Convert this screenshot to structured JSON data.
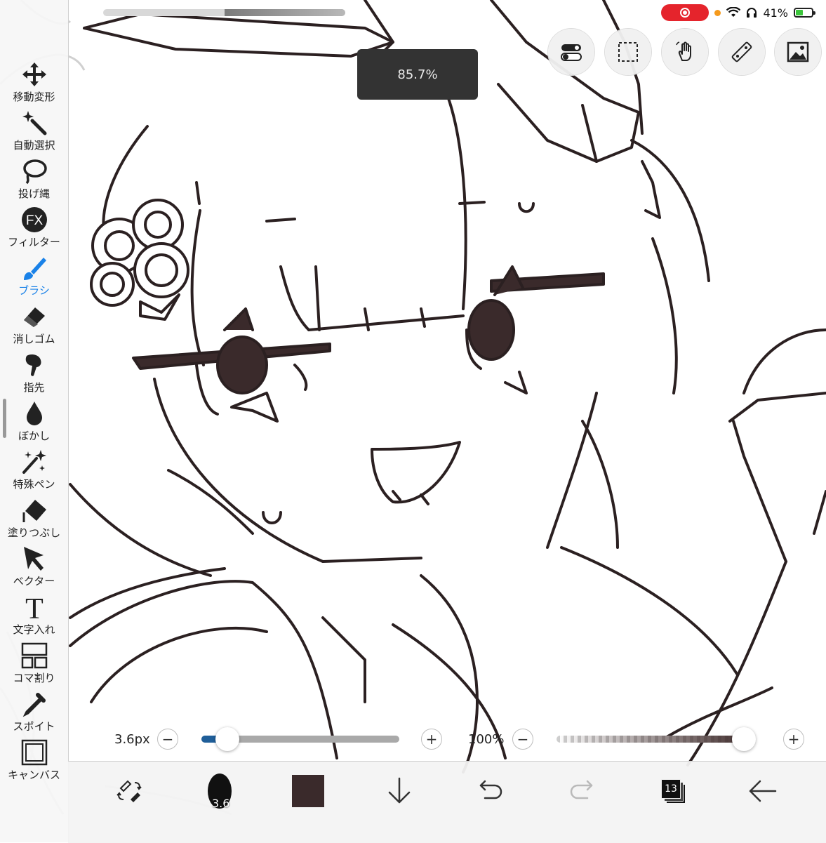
{
  "status_bar": {
    "battery_percent": "41%",
    "recording": true
  },
  "canvas": {
    "zoom_label": "85.7%"
  },
  "tools": [
    {
      "label": "移動変形",
      "icon": "move-transform-icon"
    },
    {
      "label": "自動選択",
      "icon": "magic-wand-icon"
    },
    {
      "label": "投げ縄",
      "icon": "lasso-icon"
    },
    {
      "label": "フィルター",
      "icon": "fx-filter-icon"
    },
    {
      "label": "ブラシ",
      "icon": "brush-icon",
      "active": true
    },
    {
      "label": "消しゴム",
      "icon": "eraser-icon"
    },
    {
      "label": "指先",
      "icon": "finger-smudge-icon"
    },
    {
      "label": "ぼかし",
      "icon": "blur-drop-icon"
    },
    {
      "label": "特殊ペン",
      "icon": "special-pen-icon"
    },
    {
      "label": "塗りつぶし",
      "icon": "fill-bucket-icon"
    },
    {
      "label": "ベクター",
      "icon": "vector-arrow-icon"
    },
    {
      "label": "文字入れ",
      "icon": "text-icon"
    },
    {
      "label": "コマ割り",
      "icon": "panel-split-icon"
    },
    {
      "label": "スポイト",
      "icon": "eyedropper-icon"
    },
    {
      "label": "キャンバス",
      "icon": "canvas-icon"
    }
  ],
  "top_buttons": [
    "toggle-settings-icon",
    "selection-icon",
    "gesture-hand-icon",
    "ruler-icon",
    "image-icon"
  ],
  "sliders": {
    "size_label": "3.6px",
    "size_value_fraction": 0.08,
    "opacity_label": "100%",
    "opacity_value_fraction": 1.0,
    "minus": "−",
    "plus": "+"
  },
  "bottom_bar": {
    "brush_size_label": "3.6",
    "color": "#3a2a2b",
    "layer_count": "13"
  }
}
